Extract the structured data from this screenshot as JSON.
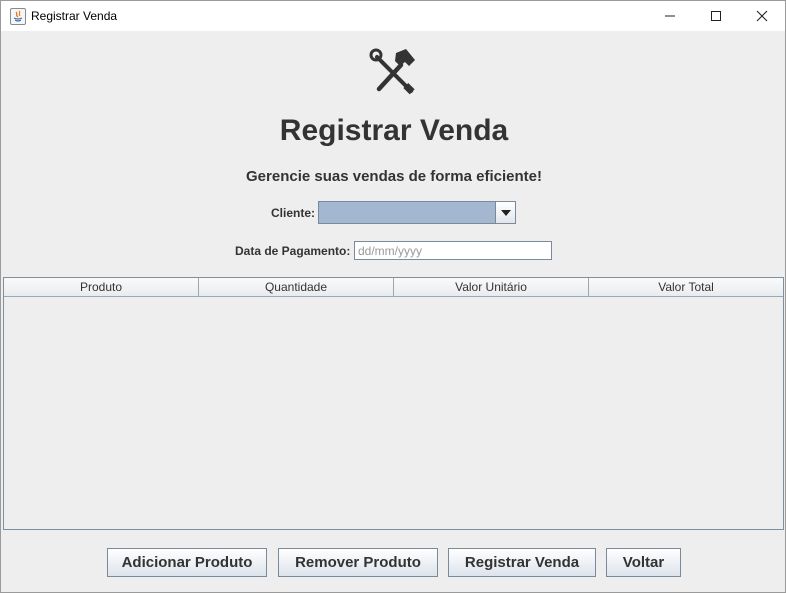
{
  "window": {
    "title": "Registrar Venda",
    "icon": "java-icon"
  },
  "header": {
    "icon": "tools-icon",
    "title": "Registrar Venda",
    "subtitle": "Gerencie suas vendas de forma eficiente!"
  },
  "form": {
    "cliente_label": "Cliente:",
    "cliente_value": "",
    "data_label": "Data de Pagamento:",
    "data_placeholder": "dd/mm/yyyy",
    "data_value": ""
  },
  "table": {
    "columns": [
      "Produto",
      "Quantidade",
      "Valor Unitário",
      "Valor Total"
    ],
    "rows": []
  },
  "buttons": {
    "add": "Adicionar Produto",
    "remove": "Remover Produto",
    "register": "Registrar Venda",
    "back": "Voltar"
  },
  "colors": {
    "combo_fill": "#a3b8d0",
    "text": "#333333",
    "background": "#eeeeee"
  }
}
